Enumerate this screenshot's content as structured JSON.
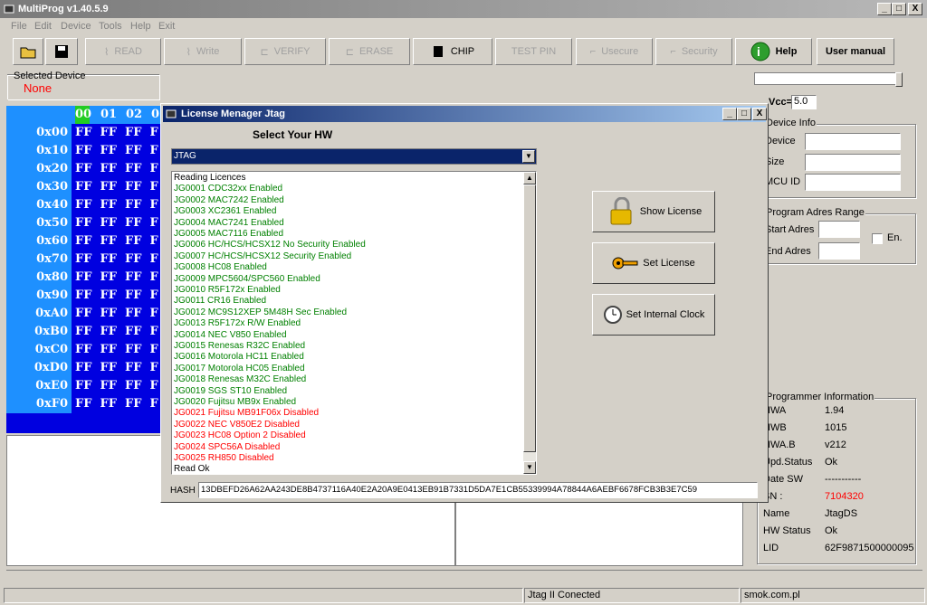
{
  "app": {
    "title": "MultiProg v1.40.5.9",
    "window_buttons": [
      "_",
      "□",
      "X"
    ]
  },
  "menu": [
    "File",
    "Edit",
    "Device",
    "Tools",
    "Help",
    "Exit"
  ],
  "toolbar": {
    "read": "READ",
    "write": "Write",
    "verify": "VERIFY",
    "erase": "ERASE",
    "chip": "CHIP",
    "test_pin": "TEST PIN",
    "usecure": "Usecure",
    "security": "Security",
    "help": "Help",
    "user_manual": "User manual"
  },
  "selected_device": {
    "label": "Selected Device",
    "value": "None",
    "value_color": "#ff0000"
  },
  "hex": {
    "header": [
      "00",
      "01",
      "02",
      "0"
    ],
    "rows": [
      {
        "addr": "0x00",
        "cells": "FF  FF  FF  F"
      },
      {
        "addr": "0x10",
        "cells": "FF  FF  FF  F"
      },
      {
        "addr": "0x20",
        "cells": "FF  FF  FF  F"
      },
      {
        "addr": "0x30",
        "cells": "FF  FF  FF  F"
      },
      {
        "addr": "0x40",
        "cells": "FF  FF  FF  F"
      },
      {
        "addr": "0x50",
        "cells": "FF  FF  FF  F"
      },
      {
        "addr": "0x60",
        "cells": "FF  FF  FF  F"
      },
      {
        "addr": "0x70",
        "cells": "FF  FF  FF  F"
      },
      {
        "addr": "0x80",
        "cells": "FF  FF  FF  F"
      },
      {
        "addr": "0x90",
        "cells": "FF  FF  FF  F"
      },
      {
        "addr": "0xA0",
        "cells": "FF  FF  FF  F"
      },
      {
        "addr": "0xB0",
        "cells": "FF  FF  FF  F"
      },
      {
        "addr": "0xC0",
        "cells": "FF  FF  FF  F"
      },
      {
        "addr": "0xD0",
        "cells": "FF  FF  FF  F"
      },
      {
        "addr": "0xE0",
        "cells": "FF  FF  FF  F"
      },
      {
        "addr": "0xF0",
        "cells": "FF  FF  FF  F"
      }
    ]
  },
  "vcc": {
    "label": "Vcc=",
    "value": "5.0"
  },
  "device_info": {
    "label": "Device Info",
    "fields": [
      "Device",
      "Size",
      "MCU ID"
    ]
  },
  "program_range": {
    "label": "Program Adres Range",
    "start": "Start Adres",
    "end": "End Adres",
    "en": "En."
  },
  "programmer_info": {
    "label": "Programmer Information",
    "rows": [
      {
        "k": "HWA",
        "v": "1.94",
        "color": "#000000"
      },
      {
        "k": "HWB",
        "v": "1015",
        "color": "#000000"
      },
      {
        "k": "HWA.B",
        "v": "v212",
        "color": "#000000"
      },
      {
        "k": "Upd.Status",
        "v": "Ok",
        "color": "#000000"
      },
      {
        "k": "Date  SW",
        "v": "-----------",
        "color": "#000000"
      },
      {
        "k": "SN :",
        "v": "7104320",
        "color": "#ff0000"
      },
      {
        "k": "Name",
        "v": "JtagDS",
        "color": "#000000"
      },
      {
        "k": "HW Status",
        "v": "Ok",
        "color": "#000000"
      },
      {
        "k": "LID",
        "v": "62F9871500000095",
        "color": "#000000"
      }
    ]
  },
  "status": {
    "conn": "Jtag II Conected",
    "site": "smok.com.pl"
  },
  "dialog": {
    "title": "License Menager Jtag",
    "heading": "Select Your HW",
    "combo": "JTAG",
    "show_license": "Show License",
    "set_license": "Set License",
    "set_clock": "Set Internal Clock",
    "hash_label": "HASH",
    "hash_value": "13DBEFD26A62AA243DE8B4737116A40E2A20A9E0413EB91B7331D5DA7E1CB55339994A78844A6AEBF6678FCB3B3E7C59",
    "lines": [
      {
        "t": "Reading Licences",
        "c": "#000000"
      },
      {
        "t": "JG0001 CDC32xx Enabled",
        "c": "#008000"
      },
      {
        "t": "JG0002 MAC7242 Enabled",
        "c": "#008000"
      },
      {
        "t": "JG0003 XC2361 Enabled",
        "c": "#008000"
      },
      {
        "t": "JG0004 MAC7241 Enabled",
        "c": "#008000"
      },
      {
        "t": "JG0005 MAC7116 Enabled",
        "c": "#008000"
      },
      {
        "t": "JG0006 HC/HCS/HCSX12 No Security Enabled",
        "c": "#008000"
      },
      {
        "t": "JG0007 HC/HCS/HCSX12 Security Enabled",
        "c": "#008000"
      },
      {
        "t": "JG0008 HC08 Enabled",
        "c": "#008000"
      },
      {
        "t": "JG0009 MPC5604/SPC560 Enabled",
        "c": "#008000"
      },
      {
        "t": "JG0010 R5F172x Enabled",
        "c": "#008000"
      },
      {
        "t": "JG0011 CR16 Enabled",
        "c": "#008000"
      },
      {
        "t": "JG0012 MC9S12XEP 5M48H Sec Enabled",
        "c": "#008000"
      },
      {
        "t": "JG0013 R5F172x R/W Enabled",
        "c": "#008000"
      },
      {
        "t": "JG0014 NEC V850 Enabled",
        "c": "#008000"
      },
      {
        "t": "JG0015 Renesas R32C Enabled",
        "c": "#008000"
      },
      {
        "t": "JG0016 Motorola HC11 Enabled",
        "c": "#008000"
      },
      {
        "t": "JG0017 Motorola HC05 Enabled",
        "c": "#008000"
      },
      {
        "t": "JG0018 Renesas M32C Enabled",
        "c": "#008000"
      },
      {
        "t": "JG0019 SGS ST10  Enabled",
        "c": "#008000"
      },
      {
        "t": "JG0020 Fujitsu MB9x  Enabled",
        "c": "#008000"
      },
      {
        "t": "JG0021 Fujitsu MB91F06x Disabled",
        "c": "#ff0000"
      },
      {
        "t": "JG0022 NEC V850E2 Disabled",
        "c": "#ff0000"
      },
      {
        "t": "JG0023 HC08 Option 2 Disabled",
        "c": "#ff0000"
      },
      {
        "t": "JG0024 SPC56A Disabled",
        "c": "#ff0000"
      },
      {
        "t": "JG0025 RH850 Disabled",
        "c": "#ff0000"
      },
      {
        "t": "Read Ok",
        "c": "#000000"
      }
    ]
  }
}
